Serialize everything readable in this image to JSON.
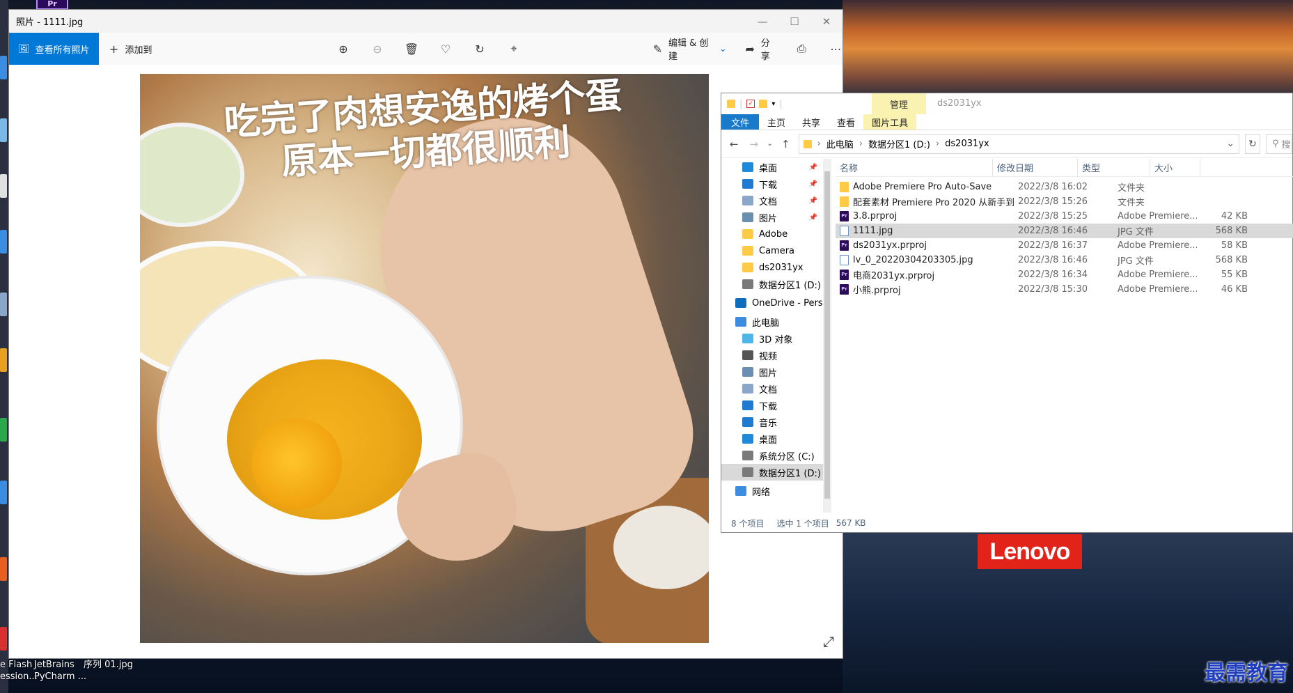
{
  "desktop": {
    "taskbar_items": [
      {
        "line1": "e Flash",
        "line2": "ession..."
      },
      {
        "line1": "JetBrains",
        "line2": "PyCharm ..."
      },
      {
        "line1": "序列 01.jpg",
        "line2": ""
      }
    ],
    "lenovo_logo": "Lenovo",
    "watermark": "最需教育",
    "pr_icon": "Pr"
  },
  "photos": {
    "title": "照片 - 1111.jpg",
    "view_all_label": "查看所有照片",
    "add_to_label": "添加到",
    "edit_create_label": "编辑 & 创建",
    "share_label": "分享",
    "caption_line1": "吃完了肉想安逸的烤个蛋",
    "caption_line2": "原本一切都很顺利",
    "icons": [
      "zoom-in-icon",
      "zoom-out-icon",
      "delete-icon",
      "heart-icon",
      "rotate-icon",
      "crop-icon",
      "print-icon",
      "more-icon"
    ]
  },
  "explorer": {
    "manage_tab": "管理",
    "title": "ds2031yx",
    "ribbon_tabs": [
      "文件",
      "主页",
      "共享",
      "查看",
      "图片工具"
    ],
    "breadcrumb": [
      "此电脑",
      "数据分区1 (D:)",
      "ds2031yx"
    ],
    "search_placeholder": "搜",
    "nav_items": [
      {
        "label": "桌面",
        "color": "#1f8ad9",
        "pinned": true
      },
      {
        "label": "下载",
        "color": "#1f7ad1",
        "pinned": true
      },
      {
        "label": "文档",
        "color": "#8aa7c9",
        "pinned": true
      },
      {
        "label": "图片",
        "color": "#6b8fb0",
        "pinned": true
      },
      {
        "label": "Adobe",
        "color": "#ffcb46",
        "pinned": false
      },
      {
        "label": "Camera",
        "color": "#ffcb46",
        "pinned": false
      },
      {
        "label": "ds2031yx",
        "color": "#ffcb46",
        "pinned": false
      },
      {
        "label": "数据分区1 (D:)",
        "color": "#7a7a7a",
        "pinned": false
      },
      {
        "label": "OneDrive - Perso",
        "color": "#0f6cbd",
        "pinned": false,
        "top": true
      },
      {
        "label": "此电脑",
        "color": "#3c8de0",
        "pinned": false,
        "top": true
      },
      {
        "label": "3D 对象",
        "color": "#4fb7e8",
        "pinned": false
      },
      {
        "label": "视频",
        "color": "#555",
        "pinned": false
      },
      {
        "label": "图片",
        "color": "#6b8fb0",
        "pinned": false
      },
      {
        "label": "文档",
        "color": "#8aa7c9",
        "pinned": false
      },
      {
        "label": "下载",
        "color": "#1f7ad1",
        "pinned": false
      },
      {
        "label": "音乐",
        "color": "#1f7ad1",
        "pinned": false
      },
      {
        "label": "桌面",
        "color": "#1f8ad9",
        "pinned": false
      },
      {
        "label": "系统分区 (C:)",
        "color": "#7a7a7a",
        "pinned": false
      },
      {
        "label": "数据分区1 (D:)",
        "color": "#7a7a7a",
        "pinned": false,
        "selected": true
      },
      {
        "label": "网络",
        "color": "#3c8de0",
        "pinned": false,
        "top": true
      }
    ],
    "columns": [
      "名称",
      "修改日期",
      "类型",
      "大小"
    ],
    "files": [
      {
        "name": "Adobe Premiere Pro Auto-Save",
        "date": "2022/3/8 16:02",
        "type": "文件夹",
        "size": "",
        "kind": "folder"
      },
      {
        "name": "配套素材 Premiere Pro 2020 从新手到...",
        "date": "2022/3/8 15:26",
        "type": "文件夹",
        "size": "",
        "kind": "folder"
      },
      {
        "name": "3.8.prproj",
        "date": "2022/3/8 15:25",
        "type": "Adobe Premiere...",
        "size": "42 KB",
        "kind": "pr"
      },
      {
        "name": "1111.jpg",
        "date": "2022/3/8 16:46",
        "type": "JPG 文件",
        "size": "568 KB",
        "kind": "jpg",
        "selected": true
      },
      {
        "name": "ds2031yx.prproj",
        "date": "2022/3/8 16:37",
        "type": "Adobe Premiere...",
        "size": "58 KB",
        "kind": "pr"
      },
      {
        "name": "lv_0_20220304203305.jpg",
        "date": "2022/3/8 16:46",
        "type": "JPG 文件",
        "size": "568 KB",
        "kind": "jpg"
      },
      {
        "name": "电商2031yx.prproj",
        "date": "2022/3/8 16:34",
        "type": "Adobe Premiere...",
        "size": "55 KB",
        "kind": "pr"
      },
      {
        "name": "小熊.prproj",
        "date": "2022/3/8 15:30",
        "type": "Adobe Premiere...",
        "size": "46 KB",
        "kind": "pr"
      }
    ],
    "status": {
      "count": "8 个项目",
      "selected": "选中 1 个项目",
      "size": "567 KB"
    }
  }
}
